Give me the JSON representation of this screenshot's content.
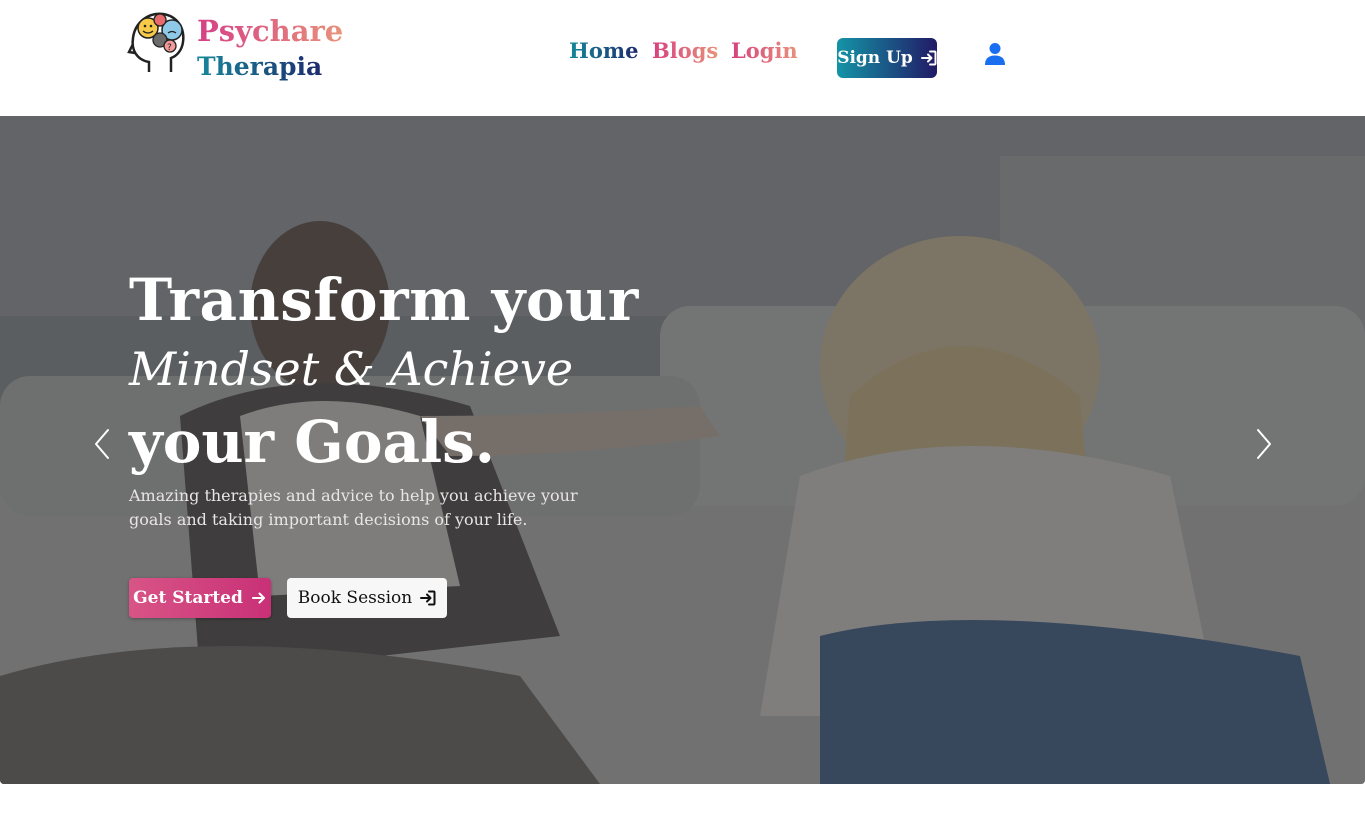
{
  "brand": {
    "line1": "Psychare",
    "line2": "Therapia",
    "logo_icon": "brain-head-emotions-icon"
  },
  "nav": {
    "home": "Home",
    "blogs": "Blogs",
    "login": "Login",
    "signup": "Sign Up",
    "signup_icon": "sign-in-icon",
    "user_icon": "user-icon"
  },
  "hero": {
    "title_line1": "Transform your",
    "title_line2": "Mindset & Achieve",
    "title_line3": "your Goals.",
    "subtitle": "Amazing therapies and advice to help you achieve your goals and taking important decisions of your life.",
    "cta_primary": "Get Started",
    "cta_primary_icon": "arrow-right-icon",
    "cta_secondary": "Book Session",
    "cta_secondary_icon": "sign-in-icon",
    "prev_icon": "chevron-left-icon",
    "next_icon": "chevron-right-icon"
  },
  "colors": {
    "brand_pink": "#d63f86",
    "brand_teal": "#17889a",
    "brand_navy": "#1d2a6e",
    "user_icon_blue": "#1a6ff0"
  }
}
